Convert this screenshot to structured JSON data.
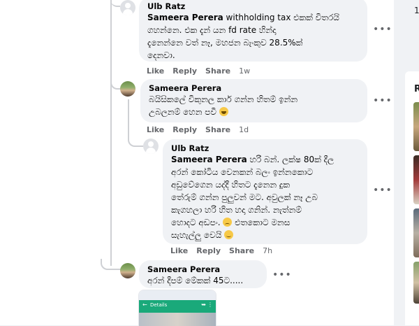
{
  "comments": [
    {
      "author": "Ulb Ratz",
      "mention": "Sameera Perera",
      "lines_first": " withholding tax එකක් විතරයි",
      "lines": [
        "ගහන්නෙ. එක දැන් යන fd rate හින්දා",
        "දැනෙන්නෙ වත් නෑ, මහජන බැංකුව 28.5%ක්",
        "දෙනවා."
      ],
      "actions": {
        "like": "Like",
        "reply": "Reply",
        "share": "Share",
        "time": "1w"
      }
    },
    {
      "author": "Sameera Perera",
      "lines": [
        "බයිසිකලේ විකුනල කාර් ගන්න හිතම් ඉන්න",
        "උබලනම් හෙන පවී"
      ],
      "actions": {
        "like": "Like",
        "reply": "Reply",
        "share": "Share",
        "time": "1d"
      }
    },
    {
      "author": "Ulb Ratz",
      "mention": "Sameera Perera",
      "lines_first": " හරි බන්. ලක්ෂ 80ක් දීල",
      "lines": [
        "අරන් කෝටිය වෙනකන් බලං ඉන්නකොට",
        "අඩුවේගෙන යද්දී හිතට දැනෙන දුක",
        "තේරුම් ගන්න පුලුවන් මට. අවුලක් නෑ උබ",
        "කැගහලා හරි හිත හදා ගනින්. නැත්නම්",
        "හොදට අඩපං.",
        " එතකොට මනස",
        "සැහැල්ලු වෙයි"
      ],
      "actions": {
        "like": "Like",
        "reply": "Reply",
        "share": "Share",
        "time": "7h"
      }
    },
    {
      "author": "Sameera Perera",
      "lines": [
        "අරන් දීපම් මේකක් 45ට....."
      ]
    }
  ],
  "attachment": {
    "title": "Details"
  },
  "right_rail": {
    "count": "1",
    "heading": "R"
  },
  "icons": [
    "more-icon",
    "default-avatar-icon",
    "profile-photo-avatar",
    "emoji-laugh-icon",
    "emoji-sad-icon",
    "emoji-smile-icon"
  ]
}
